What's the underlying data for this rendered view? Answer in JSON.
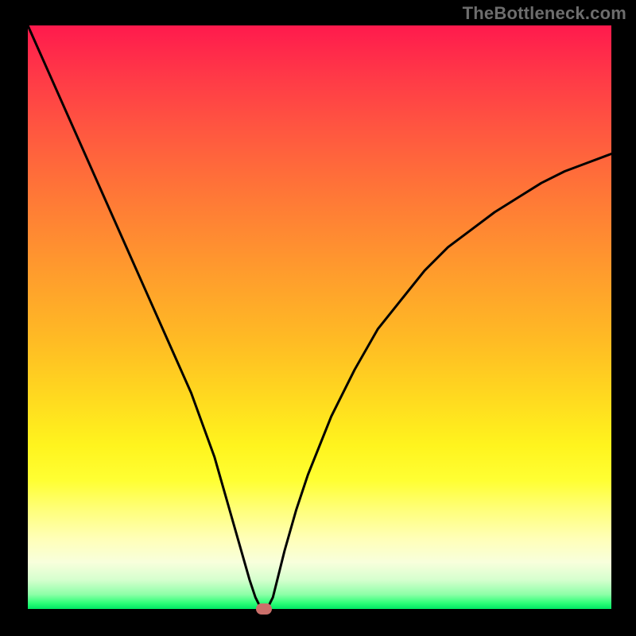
{
  "watermark": "TheBottleneck.com",
  "colors": {
    "background": "#000000",
    "curve": "#000000",
    "marker": "#cb6f6a",
    "gradient_top": "#ff1a4d",
    "gradient_bottom": "#00e763"
  },
  "chart_data": {
    "type": "line",
    "title": "",
    "xlabel": "",
    "ylabel": "",
    "xlim": [
      0,
      100
    ],
    "ylim": [
      0,
      100
    ],
    "x": [
      0,
      4,
      8,
      12,
      16,
      20,
      24,
      28,
      32,
      34,
      36,
      38,
      39,
      40,
      41,
      42,
      43,
      44,
      46,
      48,
      52,
      56,
      60,
      64,
      68,
      72,
      76,
      80,
      84,
      88,
      92,
      96,
      100
    ],
    "values": [
      100,
      91,
      82,
      73,
      64,
      55,
      46,
      37,
      26,
      19,
      12,
      5,
      2,
      0,
      0,
      2,
      6,
      10,
      17,
      23,
      33,
      41,
      48,
      53,
      58,
      62,
      65,
      68,
      70.5,
      73,
      75,
      76.5,
      78
    ],
    "marker": {
      "x": 40.5,
      "y": 0
    },
    "annotations": []
  }
}
